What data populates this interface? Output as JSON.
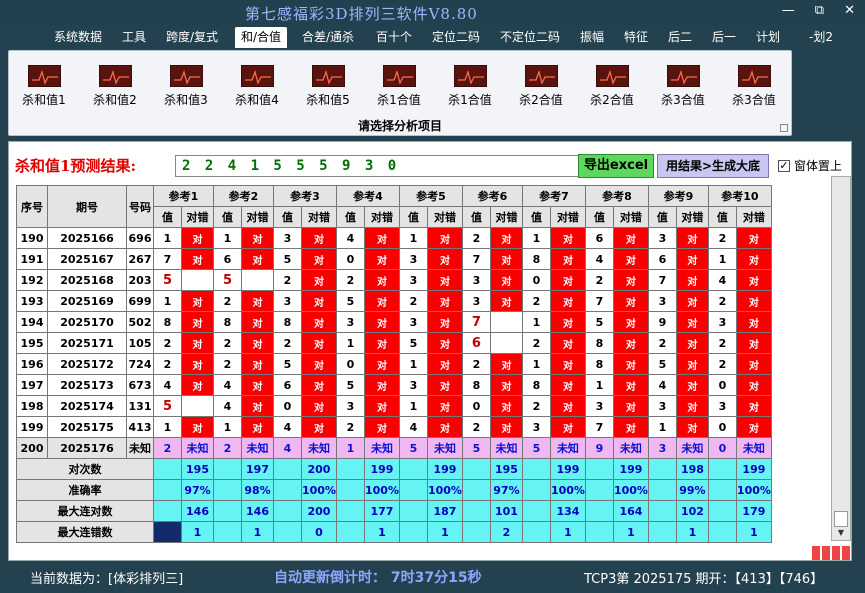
{
  "app": {
    "title": "第七感福彩3D排列三软件V8.80",
    "side_label": "-划2"
  },
  "menu": [
    "系统数据",
    "工具",
    "跨度/复式",
    "和/合值",
    "合差/通杀",
    "百十个",
    "定位二码",
    "不定位二码",
    "振幅",
    "特征",
    "后二",
    "后一",
    "计划"
  ],
  "ribbon": {
    "buttons": [
      "杀和值1",
      "杀和值2",
      "杀和值3",
      "杀和值4",
      "杀和值5",
      "杀1合值",
      "杀1合值",
      "杀2合值",
      "杀2合值",
      "杀3合值",
      "杀3合值"
    ],
    "caption": "请选择分析项目"
  },
  "prediction": {
    "label": "杀和值1预测结果:",
    "value": "2 2 4 1 5 5 5 9 3 0"
  },
  "buttons": {
    "excel": "导出excel",
    "generate": "用结果>生成大底"
  },
  "checkbox": {
    "label": "窗体置上",
    "checked": true
  },
  "table": {
    "headers": {
      "seq": "序号",
      "period": "期号",
      "code": "号码",
      "val": "值",
      "hit": "对错"
    },
    "ref_labels": [
      "参考1",
      "参考2",
      "参考3",
      "参考4",
      "参考5",
      "参考6",
      "参考7",
      "参考8",
      "参考9",
      "参考10"
    ],
    "rows": [
      {
        "seq": "190",
        "period": "2025166",
        "code": "696",
        "vals": [
          "1",
          "1",
          "3",
          "4",
          "1",
          "2",
          "1",
          "6",
          "3",
          "2"
        ],
        "hits": [
          "对",
          "对",
          "对",
          "对",
          "对",
          "对",
          "对",
          "对",
          "对",
          "对"
        ]
      },
      {
        "seq": "191",
        "period": "2025167",
        "code": "267",
        "vals": [
          "7",
          "6",
          "5",
          "0",
          "3",
          "7",
          "8",
          "4",
          "6",
          "1"
        ],
        "hits": [
          "对",
          "对",
          "对",
          "对",
          "对",
          "对",
          "对",
          "对",
          "对",
          "对"
        ]
      },
      {
        "seq": "192",
        "period": "2025168",
        "code": "203",
        "vals": [
          "5",
          "5",
          "2",
          "2",
          "3",
          "3",
          "0",
          "2",
          "7",
          "4"
        ],
        "hits": [
          "",
          "",
          "对",
          "对",
          "对",
          "对",
          "对",
          "对",
          "对",
          "对"
        ]
      },
      {
        "seq": "193",
        "period": "2025169",
        "code": "699",
        "vals": [
          "1",
          "2",
          "3",
          "5",
          "2",
          "3",
          "2",
          "7",
          "3",
          "2"
        ],
        "hits": [
          "对",
          "对",
          "对",
          "对",
          "对",
          "对",
          "对",
          "对",
          "对",
          "对"
        ]
      },
      {
        "seq": "194",
        "period": "2025170",
        "code": "502",
        "vals": [
          "8",
          "8",
          "8",
          "3",
          "3",
          "7",
          "1",
          "5",
          "9",
          "3"
        ],
        "hits": [
          "对",
          "对",
          "对",
          "对",
          "对",
          "",
          "对",
          "对",
          "对",
          "对"
        ]
      },
      {
        "seq": "195",
        "period": "2025171",
        "code": "105",
        "vals": [
          "2",
          "2",
          "2",
          "1",
          "5",
          "6",
          "2",
          "8",
          "2",
          "2"
        ],
        "hits": [
          "对",
          "对",
          "对",
          "对",
          "对",
          "",
          "对",
          "对",
          "对",
          "对"
        ]
      },
      {
        "seq": "196",
        "period": "2025172",
        "code": "724",
        "vals": [
          "2",
          "2",
          "5",
          "0",
          "1",
          "2",
          "1",
          "8",
          "5",
          "2"
        ],
        "hits": [
          "对",
          "对",
          "对",
          "对",
          "对",
          "对",
          "对",
          "对",
          "对",
          "对"
        ]
      },
      {
        "seq": "197",
        "period": "2025173",
        "code": "673",
        "vals": [
          "4",
          "4",
          "6",
          "5",
          "3",
          "8",
          "8",
          "1",
          "4",
          "0"
        ],
        "hits": [
          "对",
          "对",
          "对",
          "对",
          "对",
          "对",
          "对",
          "对",
          "对",
          "对"
        ]
      },
      {
        "seq": "198",
        "period": "2025174",
        "code": "131",
        "vals": [
          "5",
          "4",
          "0",
          "3",
          "1",
          "0",
          "2",
          "3",
          "3",
          "3"
        ],
        "hits": [
          "",
          "对",
          "对",
          "对",
          "对",
          "对",
          "对",
          "对",
          "对",
          "对"
        ]
      },
      {
        "seq": "199",
        "period": "2025175",
        "code": "413",
        "vals": [
          "1",
          "1",
          "4",
          "2",
          "4",
          "2",
          "3",
          "7",
          "1",
          "0"
        ],
        "hits": [
          "对",
          "对",
          "对",
          "对",
          "对",
          "对",
          "对",
          "对",
          "对",
          "对"
        ]
      }
    ],
    "current": {
      "seq": "200",
      "period": "2025176",
      "code": "未知",
      "vals": [
        "2",
        "2",
        "4",
        "1",
        "5",
        "5",
        "5",
        "9",
        "3",
        "0"
      ],
      "hit_label": "未知"
    },
    "summary": [
      {
        "label": "对次数",
        "values": [
          "195",
          "197",
          "200",
          "199",
          "199",
          "195",
          "199",
          "199",
          "198",
          "199"
        ]
      },
      {
        "label": "准确率",
        "values": [
          "97%",
          "98%",
          "100%",
          "100%",
          "100%",
          "97%",
          "100%",
          "100%",
          "99%",
          "100%"
        ]
      },
      {
        "label": "最大连对数",
        "values": [
          "146",
          "146",
          "200",
          "177",
          "187",
          "101",
          "134",
          "164",
          "102",
          "179"
        ]
      },
      {
        "label": "最大连错数",
        "values": [
          "1",
          "1",
          "0",
          "1",
          "1",
          "2",
          "1",
          "1",
          "1",
          "1"
        ]
      }
    ]
  },
  "status": {
    "current_data": "当前数据为：[体彩排列三]",
    "countdown": "自动更新倒计时： 7时37分15秒",
    "info": "TCP3第 2025175 期开：【413】【746】"
  },
  "colors": {
    "hit_red": "#f80000",
    "current_pink": "#f0b8f0",
    "summary_cyan": "#66f3f3",
    "bg": "#24414f"
  }
}
